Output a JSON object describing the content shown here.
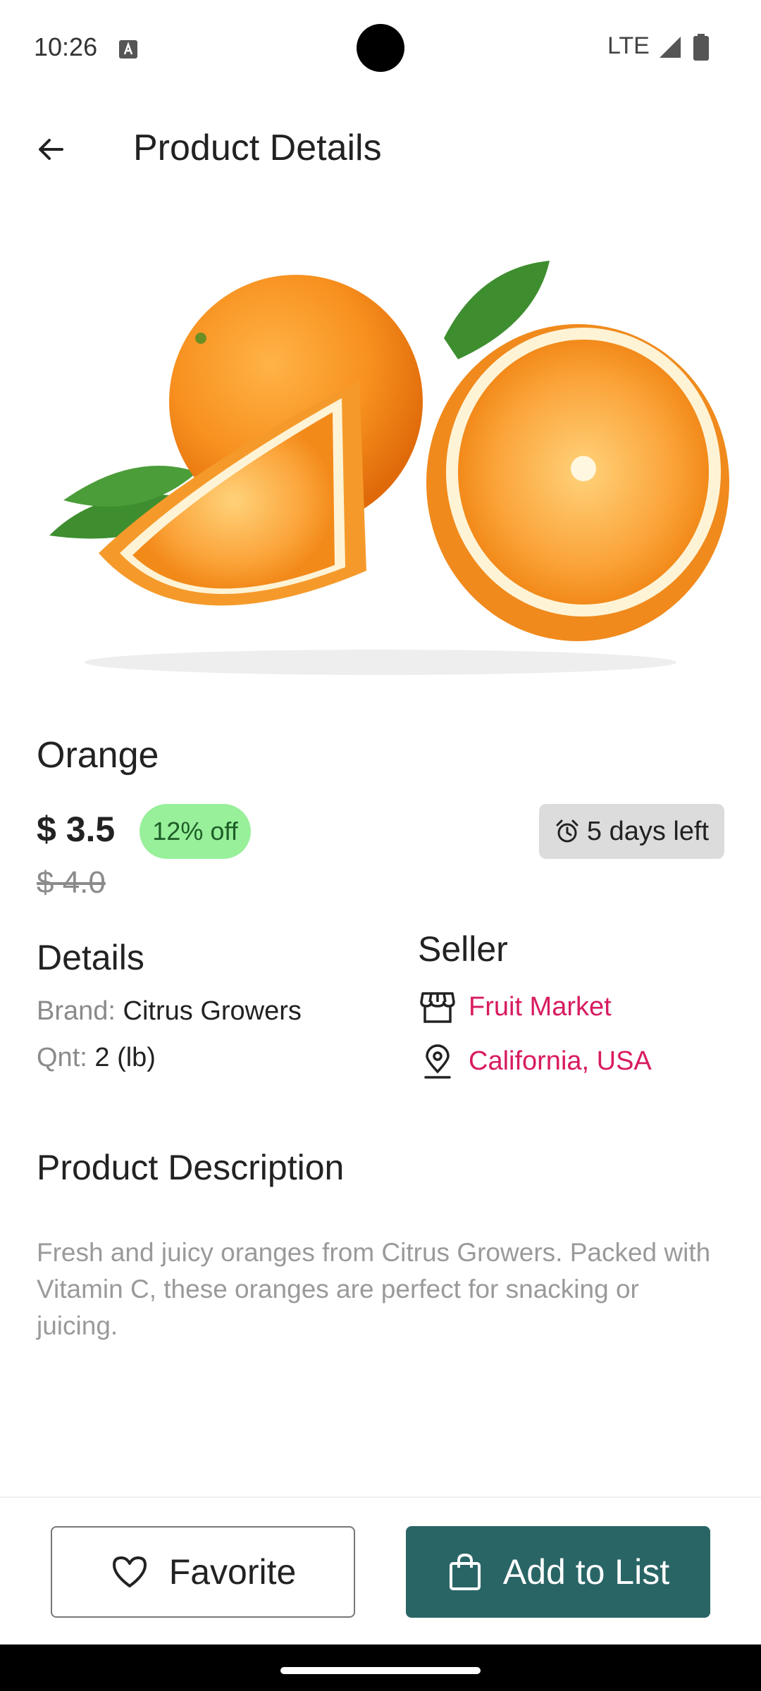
{
  "status_bar": {
    "time": "10:26",
    "network": "LTE",
    "icons": [
      "a-notification-icon",
      "camera-cutout",
      "signal-icon",
      "battery-icon"
    ]
  },
  "app_bar": {
    "title": "Product Details",
    "back_icon": "arrow-left-icon"
  },
  "product": {
    "name": "Orange",
    "price": "$ 3.5",
    "old_price": "$ 4.0",
    "discount": "12% off",
    "days_left": "5 days left",
    "days_left_icon": "alarm-clock-icon"
  },
  "details": {
    "heading": "Details",
    "brand_label": "Brand:",
    "brand_value": "Citrus Growers",
    "qnt_label": "Qnt:",
    "qnt_value": "2 (lb)"
  },
  "seller": {
    "heading": "Seller",
    "name": "Fruit Market",
    "name_icon": "storefront-icon",
    "location": "California, USA",
    "location_icon": "location-pin-icon"
  },
  "description": {
    "heading": "Product Description",
    "text": "Fresh and juicy oranges from Citrus Growers. Packed with Vitamin C, these oranges are perfect for snacking or juicing."
  },
  "actions": {
    "favorite_label": "Favorite",
    "favorite_icon": "heart-outline-icon",
    "add_label": "Add to List",
    "add_icon": "shopping-bag-icon"
  },
  "colors": {
    "accent_pink": "#d81b60",
    "primary_teal": "#2a6566",
    "discount_green": "#98f09a"
  }
}
